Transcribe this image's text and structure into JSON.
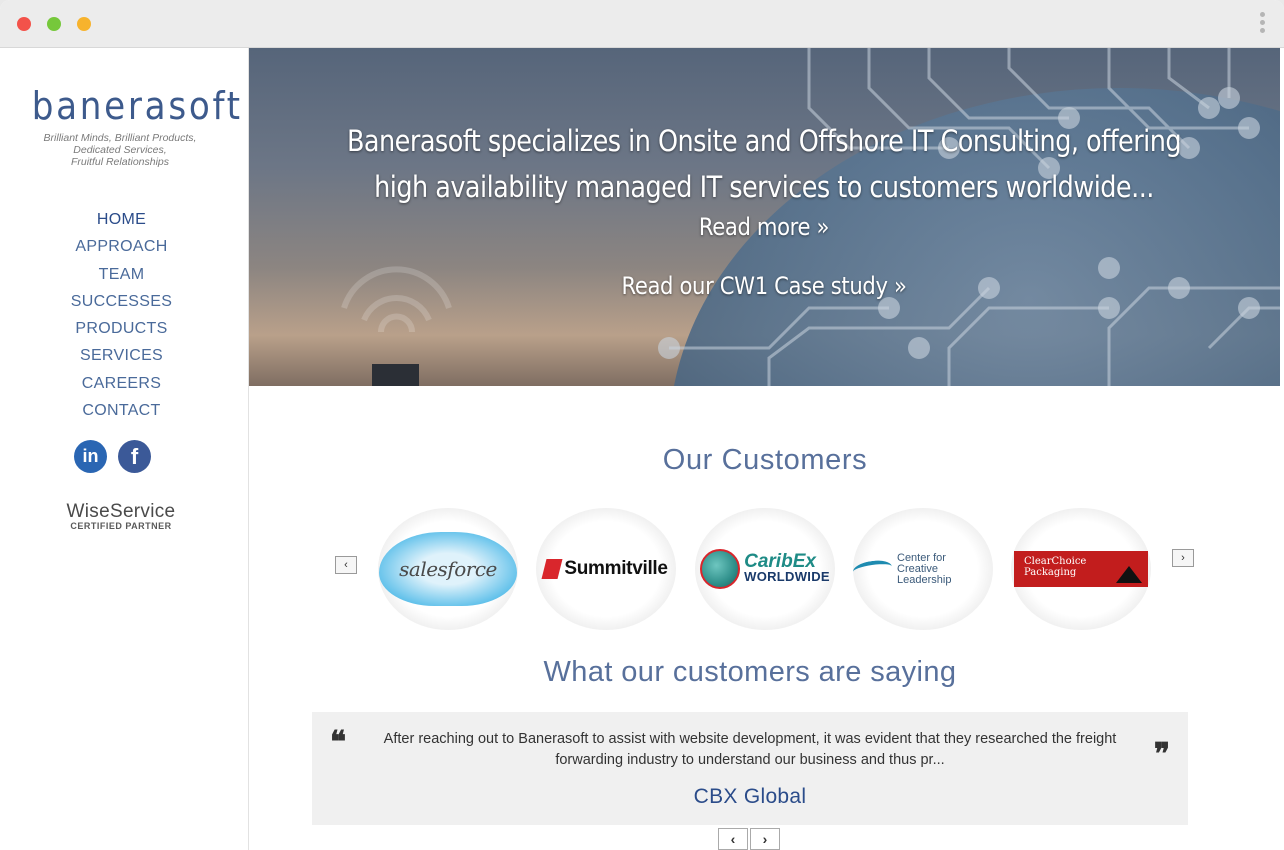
{
  "brand": {
    "logo_text": "banerasoft",
    "tagline": [
      "Brilliant Minds, Brilliant Products,",
      "Dedicated Services,",
      "Fruitful Relationships"
    ]
  },
  "nav": {
    "items": [
      {
        "label": "HOME",
        "active": true
      },
      {
        "label": "APPROACH"
      },
      {
        "label": "TEAM"
      },
      {
        "label": "SUCCESSES"
      },
      {
        "label": "PRODUCTS"
      },
      {
        "label": "SERVICES"
      },
      {
        "label": "CAREERS"
      },
      {
        "label": "CONTACT"
      }
    ]
  },
  "social": {
    "linkedin": "in",
    "facebook": "f"
  },
  "partner": {
    "title": "WiseService",
    "subtitle": "CERTIFIED PARTNER"
  },
  "hero": {
    "line1": "Banerasoft specializes in Onsite and Offshore IT Consulting, offering",
    "line2": "high availability managed IT services to customers worldwide...",
    "read_more": "Read more »",
    "case_study": "Read our CW1 Case study »"
  },
  "customers": {
    "title": "Our Customers",
    "prev": "‹",
    "next": "›",
    "logos": {
      "salesforce": "salesforce",
      "summitville": "Summitville",
      "caribex_1": "CaribEx",
      "caribex_2": "WORLDWIDE",
      "ccl_1": "Center for",
      "ccl_2": "Creative Leadership",
      "clearchoice_1": "ClearChoice",
      "clearchoice_2": "Packaging"
    }
  },
  "testimonials": {
    "title": "What our customers are saying",
    "text": "After reaching out to Banerasoft to assist with website development, it was evident that they researched the freight forwarding industry to understand our business and thus pr...",
    "author": "CBX Global",
    "prev": "‹",
    "next": "›"
  },
  "colors": {
    "accent": "#58709b",
    "nav": "#4a6a9a",
    "author": "#2b4c8a"
  }
}
